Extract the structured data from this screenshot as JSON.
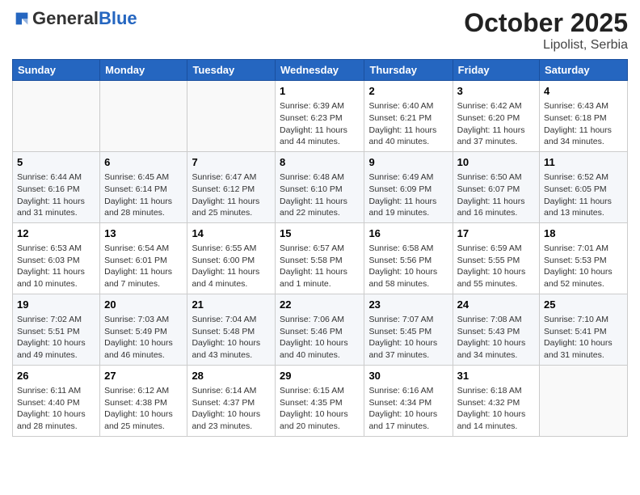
{
  "header": {
    "logo_general": "General",
    "logo_blue": "Blue",
    "month": "October 2025",
    "location": "Lipolist, Serbia"
  },
  "weekdays": [
    "Sunday",
    "Monday",
    "Tuesday",
    "Wednesday",
    "Thursday",
    "Friday",
    "Saturday"
  ],
  "weeks": [
    [
      {
        "day": "",
        "info": ""
      },
      {
        "day": "",
        "info": ""
      },
      {
        "day": "",
        "info": ""
      },
      {
        "day": "1",
        "info": "Sunrise: 6:39 AM\nSunset: 6:23 PM\nDaylight: 11 hours\nand 44 minutes."
      },
      {
        "day": "2",
        "info": "Sunrise: 6:40 AM\nSunset: 6:21 PM\nDaylight: 11 hours\nand 40 minutes."
      },
      {
        "day": "3",
        "info": "Sunrise: 6:42 AM\nSunset: 6:20 PM\nDaylight: 11 hours\nand 37 minutes."
      },
      {
        "day": "4",
        "info": "Sunrise: 6:43 AM\nSunset: 6:18 PM\nDaylight: 11 hours\nand 34 minutes."
      }
    ],
    [
      {
        "day": "5",
        "info": "Sunrise: 6:44 AM\nSunset: 6:16 PM\nDaylight: 11 hours\nand 31 minutes."
      },
      {
        "day": "6",
        "info": "Sunrise: 6:45 AM\nSunset: 6:14 PM\nDaylight: 11 hours\nand 28 minutes."
      },
      {
        "day": "7",
        "info": "Sunrise: 6:47 AM\nSunset: 6:12 PM\nDaylight: 11 hours\nand 25 minutes."
      },
      {
        "day": "8",
        "info": "Sunrise: 6:48 AM\nSunset: 6:10 PM\nDaylight: 11 hours\nand 22 minutes."
      },
      {
        "day": "9",
        "info": "Sunrise: 6:49 AM\nSunset: 6:09 PM\nDaylight: 11 hours\nand 19 minutes."
      },
      {
        "day": "10",
        "info": "Sunrise: 6:50 AM\nSunset: 6:07 PM\nDaylight: 11 hours\nand 16 minutes."
      },
      {
        "day": "11",
        "info": "Sunrise: 6:52 AM\nSunset: 6:05 PM\nDaylight: 11 hours\nand 13 minutes."
      }
    ],
    [
      {
        "day": "12",
        "info": "Sunrise: 6:53 AM\nSunset: 6:03 PM\nDaylight: 11 hours\nand 10 minutes."
      },
      {
        "day": "13",
        "info": "Sunrise: 6:54 AM\nSunset: 6:01 PM\nDaylight: 11 hours\nand 7 minutes."
      },
      {
        "day": "14",
        "info": "Sunrise: 6:55 AM\nSunset: 6:00 PM\nDaylight: 11 hours\nand 4 minutes."
      },
      {
        "day": "15",
        "info": "Sunrise: 6:57 AM\nSunset: 5:58 PM\nDaylight: 11 hours\nand 1 minute."
      },
      {
        "day": "16",
        "info": "Sunrise: 6:58 AM\nSunset: 5:56 PM\nDaylight: 10 hours\nand 58 minutes."
      },
      {
        "day": "17",
        "info": "Sunrise: 6:59 AM\nSunset: 5:55 PM\nDaylight: 10 hours\nand 55 minutes."
      },
      {
        "day": "18",
        "info": "Sunrise: 7:01 AM\nSunset: 5:53 PM\nDaylight: 10 hours\nand 52 minutes."
      }
    ],
    [
      {
        "day": "19",
        "info": "Sunrise: 7:02 AM\nSunset: 5:51 PM\nDaylight: 10 hours\nand 49 minutes."
      },
      {
        "day": "20",
        "info": "Sunrise: 7:03 AM\nSunset: 5:49 PM\nDaylight: 10 hours\nand 46 minutes."
      },
      {
        "day": "21",
        "info": "Sunrise: 7:04 AM\nSunset: 5:48 PM\nDaylight: 10 hours\nand 43 minutes."
      },
      {
        "day": "22",
        "info": "Sunrise: 7:06 AM\nSunset: 5:46 PM\nDaylight: 10 hours\nand 40 minutes."
      },
      {
        "day": "23",
        "info": "Sunrise: 7:07 AM\nSunset: 5:45 PM\nDaylight: 10 hours\nand 37 minutes."
      },
      {
        "day": "24",
        "info": "Sunrise: 7:08 AM\nSunset: 5:43 PM\nDaylight: 10 hours\nand 34 minutes."
      },
      {
        "day": "25",
        "info": "Sunrise: 7:10 AM\nSunset: 5:41 PM\nDaylight: 10 hours\nand 31 minutes."
      }
    ],
    [
      {
        "day": "26",
        "info": "Sunrise: 6:11 AM\nSunset: 4:40 PM\nDaylight: 10 hours\nand 28 minutes."
      },
      {
        "day": "27",
        "info": "Sunrise: 6:12 AM\nSunset: 4:38 PM\nDaylight: 10 hours\nand 25 minutes."
      },
      {
        "day": "28",
        "info": "Sunrise: 6:14 AM\nSunset: 4:37 PM\nDaylight: 10 hours\nand 23 minutes."
      },
      {
        "day": "29",
        "info": "Sunrise: 6:15 AM\nSunset: 4:35 PM\nDaylight: 10 hours\nand 20 minutes."
      },
      {
        "day": "30",
        "info": "Sunrise: 6:16 AM\nSunset: 4:34 PM\nDaylight: 10 hours\nand 17 minutes."
      },
      {
        "day": "31",
        "info": "Sunrise: 6:18 AM\nSunset: 4:32 PM\nDaylight: 10 hours\nand 14 minutes."
      },
      {
        "day": "",
        "info": ""
      }
    ]
  ]
}
